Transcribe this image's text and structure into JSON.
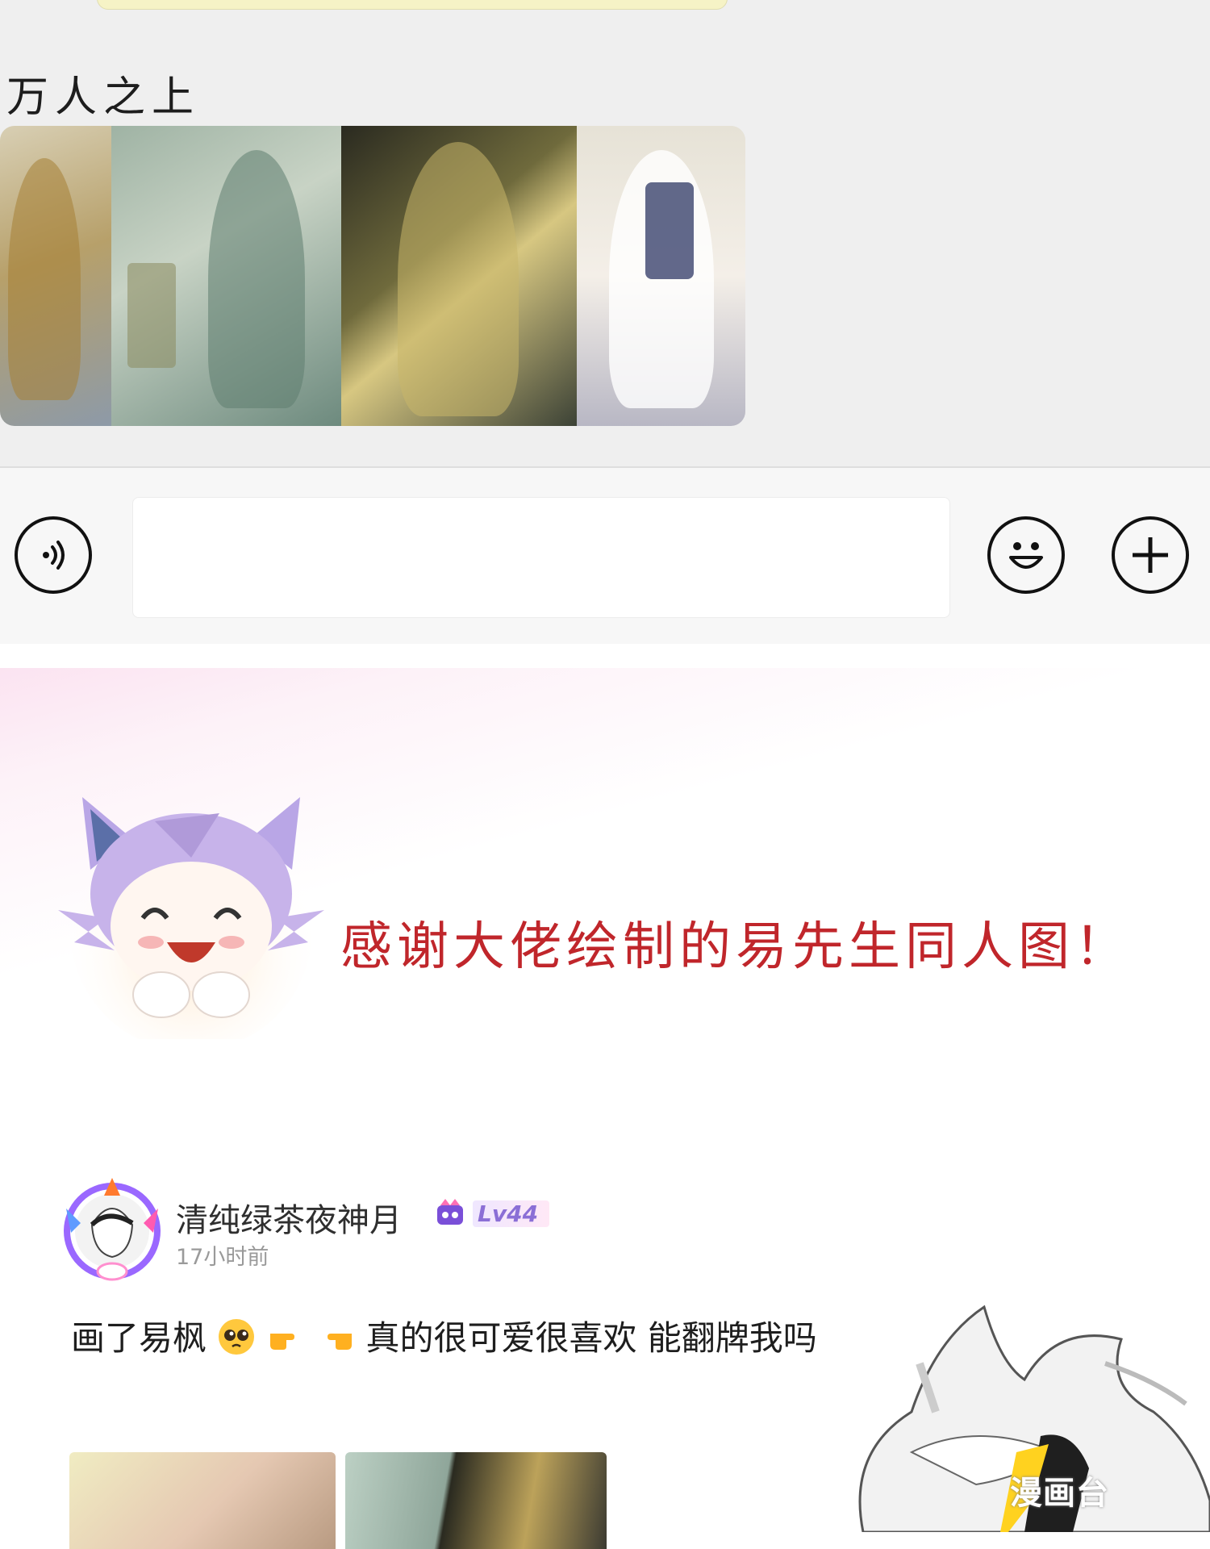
{
  "chat": {
    "caption": "万人之上"
  },
  "input_bar": {
    "placeholder": ""
  },
  "thanks_banner": {
    "text": "感谢大佬绘制的易先生同人图！"
  },
  "post": {
    "username": "清纯绿茶夜神月",
    "level": "Lv44",
    "timestamp": "17小时前",
    "text_part1": "画了易枫",
    "text_part2": "真的很可爱很喜欢 能翻牌我吗"
  },
  "colors": {
    "thanks_text": "#c0262b",
    "level_text": "#8b6fd6",
    "chat_bg": "#efefef"
  }
}
